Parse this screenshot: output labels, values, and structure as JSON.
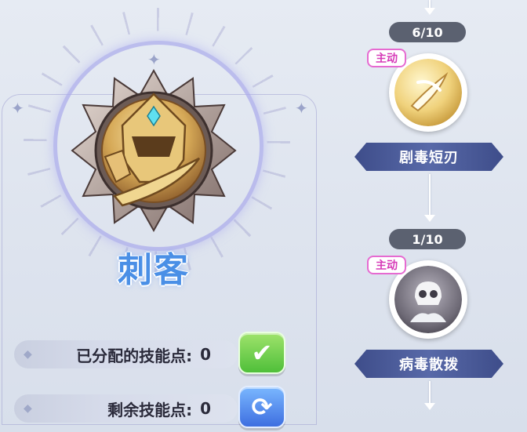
{
  "class_panel": {
    "class_name": "刺客",
    "allocated": {
      "label": "已分配的技能点:",
      "value": "0"
    },
    "remaining": {
      "label": "剩余技能点:",
      "value": "0"
    }
  },
  "skill_tree": {
    "skills": [
      {
        "level": "6/10",
        "badge": "主动",
        "name": "剧毒短刃",
        "icon": "poison-dagger-icon"
      },
      {
        "level": "1/10",
        "badge": "主动",
        "name": "病毒散拨",
        "icon": "virus-spread-icon"
      }
    ]
  },
  "colors": {
    "class_name": "#4a8fe6",
    "confirm_button": "#4fbf3a",
    "reset_button": "#3e6fe0",
    "badge_border": "#e66ad1",
    "skill_label_bg": "#4a5a98"
  }
}
